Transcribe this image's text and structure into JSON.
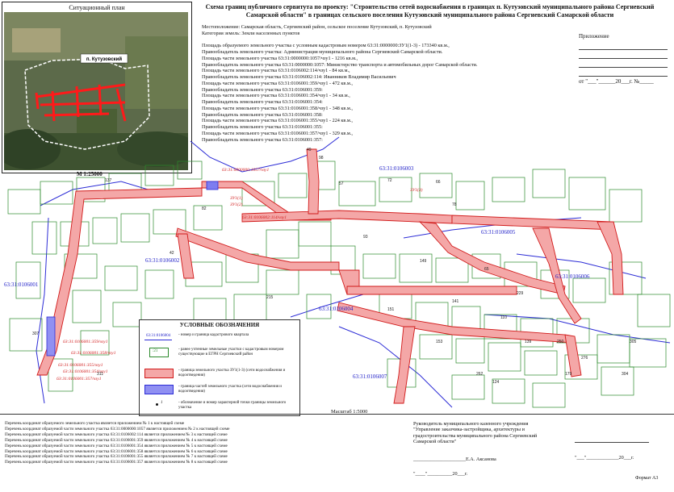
{
  "situational_plan": {
    "title": "Ситуационный план",
    "place_label": "п. Кутузовский"
  },
  "scale_top": "М 1:25000",
  "header": {
    "title": "Схема границ публичного сервитута по проекту: \"Строительство сетей водоснабжения в границах п. Кутузовский муниципального района Сергиевский Самарской области\" в границах сельского поселения Кутузовский муниципального района Сергиевский Самарской области",
    "info_lines": [
      "Местоположение: Самарская область, Сергиевский район, сельское поселение Кутузовский, п. Кутузовский",
      "Категория земель: Земли населенных пунктов",
      "",
      "Площадь образуемого земельного участка с условным кадастровым номером 63:31:0000000:ЗУ1(1-3) - 173340 кв.м.,",
      "Правообладатель земельного участка: Администрация муниципального района Сергиевский Самарской области.",
      "Площадь части земельного участка 63:31:0000000:1057/чзу1 - 1216 кв.м.,",
      "Правообладатель земельного участка 63:31:0000000:1057: Министерство транспорта и автомобильных дорог Самарской области.",
      "Площадь части земельного участка 63:31:0106002:114/чзу1 - 84 кв.м.,",
      "Правообладатель земельного участка 63:31:0106002:114: Иванников Владимир Васильевич",
      "Площадь части земельного участка 63:31:0106001:359/чзу1 - 472 кв.м.,",
      "Правообладатель земельного участка 63:31:0106001:359:",
      "Площадь части земельного участка 63:31:0106001:354/чзу1 - 34 кв.м.,",
      "Правообладатель земельного участка 63:31:0106001:354:",
      "Площадь части земельного участка 63:31:0106001:358/чзу1 - 348 кв.м.,",
      "Правообладатель земельного участка 63:31:0106001:358:",
      "Площадь части земельного участка 63:31:0106001:355/чзу1 - 224 кв.м.,",
      "Правообладатель земельного участка 63:31:0106001:355:",
      "Площадь части земельного участка 63:31:0106001:357/чзу1 - 329 кв.м.,",
      "Правообладатель земельного участка 63:31:0106001:357:"
    ]
  },
  "appendix": {
    "label": "Приложение",
    "date_line": "от \"___\"______20___г. №_____"
  },
  "map": {
    "cadastral_quarters": [
      "63:31:0106003",
      "63:31:0106002",
      "63:31:0106001",
      "63:31:0106004",
      "63:31:0106005",
      "63:31:0106006",
      "63:31:0106007"
    ],
    "servitude_labels": [
      "63:31:0000000:1057/чзу1",
      "ЗУ1(1)",
      "ЗУ1(2)",
      "ЗУ1(3)",
      "63:31:0106002:114/чзу1",
      "63:31:0106001:359/чзу1",
      "63:31:0106001:358/чзу1",
      "63:31:0106001:355/чзу1",
      "63:31:0106001:354/чзу1",
      "63:31:0106001:357/чзу1"
    ],
    "parcel_numbers": [
      "49",
      "98",
      "57",
      "66",
      "72",
      "149",
      "65",
      "141",
      "110",
      "139",
      "153",
      "124",
      "179",
      "151",
      "262",
      "250",
      "276",
      "304",
      "305",
      "229",
      "137",
      "82",
      "42",
      "78",
      "93",
      "215",
      "311",
      "307"
    ]
  },
  "legend": {
    "title": "УСЛОВНЫЕ ОБОЗНАЧЕНИЯ",
    "items": [
      {
        "symbol": "63:31:0106004",
        "text": "- номер и граница кадастрового квартала"
      },
      {
        "symbol": ":21",
        "text": "- ранее учтенные земельные участки с кадастровым номером существующие в ЕГРН Сергиевский район"
      },
      {
        "symbol": "",
        "text": "- граница земельного участка ЗУ1(1-3) (сети водоснабжения и водоотведения)"
      },
      {
        "symbol": "",
        "text": "- граница частей земельного участка (сети водоснабжения и водоотведения)"
      },
      {
        "symbol": "1",
        "text": "- обозначение и номер характерной точки границы земельного участка"
      }
    ]
  },
  "scale_bottom": "Масштаб 1:5000",
  "footer": {
    "notes": [
      "Перечень координат образуемого земельного участка является приложением № 1 к настоящей схеме",
      "Перечень координат образуемой части земельного участка 63:31:0000000:1057 является приложением № 2 к настоящей схеме",
      "Перечень координат образуемой части земельного участка 63:31:0106002:114 является приложением № 3 к настоящей схеме",
      "Перечень координат образуемой части земельного участка 63:31:0106001:359 является приложением № 4 к настоящей схеме",
      "Перечень координат образуемой части земельного участка 63:31:0106001:354 является приложением № 5 к настоящей схеме",
      "Перечень координат образуемой части земельного участка 63:31:0106001:358 является приложением № 6 к настоящей схеме",
      "Перечень координат образуемой части земельного участка 63:31:0106001:355 является приложением № 7 к настоящей схеме",
      "Перечень координат образуемой части земельного участка 63:31:0106001:357 является приложением № 8 к настоящей схеме"
    ],
    "signatory": "Руководитель муниципального казенного учреждения \"Управление заказчика-застройщика, архитектуры и градостроительства муниципального района Сергиевский Самарской области\"",
    "sign_name": "_____________________Е.А. Аксанова",
    "sign_date": "\"___\"_____________20___г.",
    "sign_date_short": "\"____\"__________20___г.",
    "format": "Формат А3"
  },
  "colors": {
    "servitude_fill": "#f4a7a7",
    "servitude_stroke": "#d11a1a",
    "quarter_line": "#2c2cd6",
    "parcel_line": "#2d8a2d",
    "label_red": "#d11a1a"
  }
}
